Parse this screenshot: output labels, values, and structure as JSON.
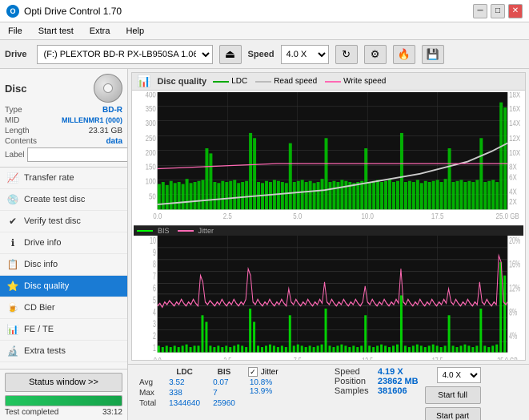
{
  "titleBar": {
    "title": "Opti Drive Control 1.70",
    "minimize": "─",
    "maximize": "□",
    "close": "✕"
  },
  "menuBar": {
    "items": [
      "File",
      "Start test",
      "Extra",
      "Help"
    ]
  },
  "toolbar": {
    "driveLabel": "Drive",
    "driveValue": "(F:) PLEXTOR BD-R  PX-LB950SA 1.06",
    "speedLabel": "Speed",
    "speedValue": "4.0 X"
  },
  "disc": {
    "label": "Disc",
    "typeKey": "Type",
    "typeVal": "BD-R",
    "midKey": "MID",
    "midVal": "MILLENMR1 (000)",
    "lengthKey": "Length",
    "lengthVal": "23.31 GB",
    "contentsKey": "Contents",
    "contentsVal": "data",
    "labelKey": "Label",
    "labelVal": "",
    "labelPlaceholder": ""
  },
  "nav": {
    "items": [
      {
        "id": "transfer-rate",
        "label": "Transfer rate",
        "icon": "📈"
      },
      {
        "id": "create-test-disc",
        "label": "Create test disc",
        "icon": "💿"
      },
      {
        "id": "verify-test-disc",
        "label": "Verify test disc",
        "icon": "✔"
      },
      {
        "id": "drive-info",
        "label": "Drive info",
        "icon": "ℹ"
      },
      {
        "id": "disc-info",
        "label": "Disc info",
        "icon": "📋"
      },
      {
        "id": "disc-quality",
        "label": "Disc quality",
        "icon": "⭐",
        "active": true
      },
      {
        "id": "cd-bier",
        "label": "CD Bier",
        "icon": "🍺"
      },
      {
        "id": "fe-te",
        "label": "FE / TE",
        "icon": "📊"
      },
      {
        "id": "extra-tests",
        "label": "Extra tests",
        "icon": "🔬"
      }
    ]
  },
  "status": {
    "buttonLabel": "Status window >>",
    "progressPercent": 100,
    "statusText": "Test completed",
    "timeText": "33:12"
  },
  "chart": {
    "title": "Disc quality",
    "legends": [
      {
        "id": "ldc",
        "label": "LDC",
        "color": "#00aa00"
      },
      {
        "id": "read-speed",
        "label": "Read speed",
        "color": "#ffffff"
      },
      {
        "id": "write-speed",
        "label": "Write speed",
        "color": "#ff69b4"
      }
    ],
    "legends2": [
      {
        "id": "bis",
        "label": "BIS",
        "color": "#00ff00"
      },
      {
        "id": "jitter",
        "label": "Jitter",
        "color": "#ff69b4"
      }
    ],
    "topChart": {
      "yLeftMax": 400,
      "yRightMax": 18,
      "xMax": 25,
      "xLabel": "GB"
    },
    "bottomChart": {
      "yLeftMax": 10,
      "yRightMax": 20,
      "xMax": 25,
      "xLabel": "GB"
    }
  },
  "statsTable": {
    "headers": [
      "",
      "LDC",
      "BIS",
      "",
      "Jitter",
      "Speed",
      ""
    ],
    "rows": [
      {
        "label": "Avg",
        "ldc": "3.52",
        "bis": "0.07",
        "jitter": "10.8%",
        "speed": "4.19 X"
      },
      {
        "label": "Max",
        "ldc": "338",
        "bis": "7",
        "jitter": "13.9%",
        "position": "23862 MB"
      },
      {
        "label": "Total",
        "ldc": "1344640",
        "bis": "25960",
        "samples": "381606"
      }
    ],
    "jitterChecked": true,
    "jitterLabel": "Jitter",
    "speedLabel": "Speed",
    "speedVal": "4.19 X",
    "speedSelectVal": "4.0 X",
    "positionLabel": "Position",
    "positionVal": "23862 MB",
    "samplesLabel": "Samples",
    "samplesVal": "381606",
    "startFullLabel": "Start full",
    "startPartLabel": "Start part"
  }
}
